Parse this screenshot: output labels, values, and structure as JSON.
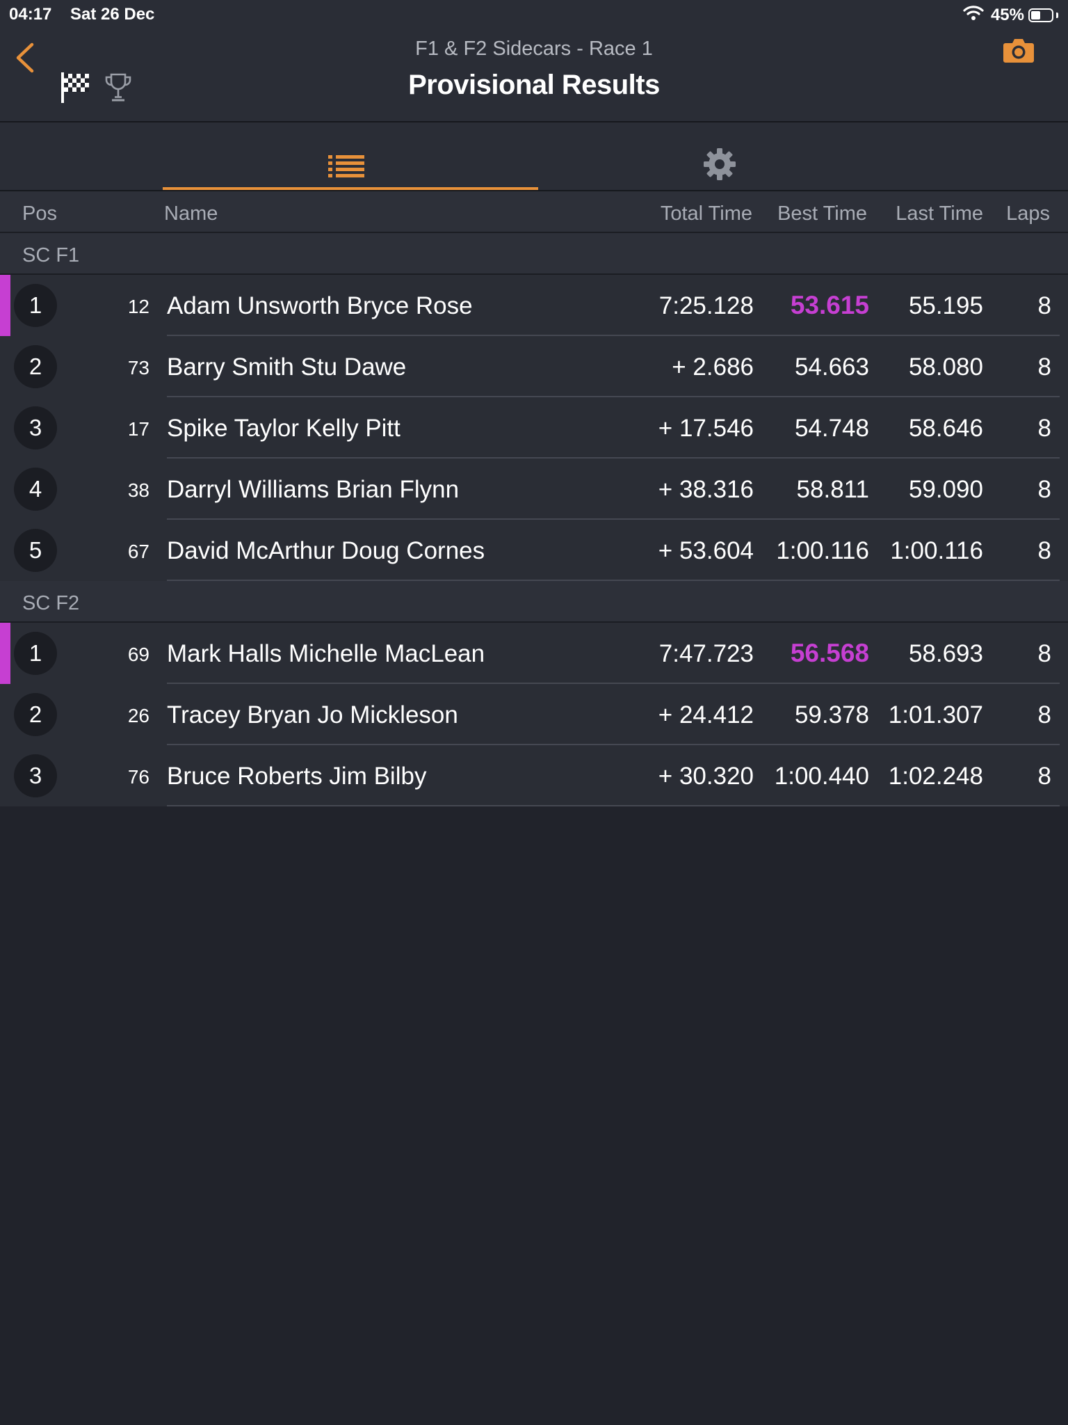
{
  "status_bar": {
    "time": "04:17",
    "date": "Sat 26 Dec",
    "battery": "45%",
    "battery_level": 0.45
  },
  "header": {
    "subtitle": "F1 & F2 Sidecars - Race 1",
    "title": "Provisional Results"
  },
  "icons": {
    "back": "chevron-left-icon",
    "flag": "checkered-flag-icon",
    "trophy": "trophy-icon",
    "camera": "camera-icon",
    "list": "list-icon",
    "settings": "gear-icon",
    "wifi": "wifi-icon",
    "battery": "battery-icon"
  },
  "colors": {
    "accent": "#e8913a",
    "leader": "#c63fd2",
    "background": "#21232b"
  },
  "tabs": [
    {
      "name": "list",
      "active": true
    },
    {
      "name": "settings",
      "active": false
    }
  ],
  "columns": {
    "pos": "Pos",
    "name": "Name",
    "total": "Total Time",
    "best": "Best Time",
    "last": "Last Time",
    "laps": "Laps"
  },
  "groups": [
    {
      "name": "SC F1",
      "rows": [
        {
          "pos": "1",
          "num": "12",
          "name": "Adam Unsworth Bryce Rose",
          "total": "7:25.128",
          "best": "53.615",
          "last": "55.195",
          "laps": "8",
          "leader": true
        },
        {
          "pos": "2",
          "num": "73",
          "name": "Barry Smith Stu Dawe",
          "total": "+ 2.686",
          "best": "54.663",
          "last": "58.080",
          "laps": "8",
          "leader": false
        },
        {
          "pos": "3",
          "num": "17",
          "name": "Spike Taylor Kelly Pitt",
          "total": "+ 17.546",
          "best": "54.748",
          "last": "58.646",
          "laps": "8",
          "leader": false
        },
        {
          "pos": "4",
          "num": "38",
          "name": "Darryl Williams Brian Flynn",
          "total": "+ 38.316",
          "best": "58.811",
          "last": "59.090",
          "laps": "8",
          "leader": false
        },
        {
          "pos": "5",
          "num": "67",
          "name": "David McArthur Doug Cornes",
          "total": "+ 53.604",
          "best": "1:00.116",
          "last": "1:00.116",
          "laps": "8",
          "leader": false
        }
      ]
    },
    {
      "name": "SC F2",
      "rows": [
        {
          "pos": "1",
          "num": "69",
          "name": "Mark Halls Michelle MacLean",
          "total": "7:47.723",
          "best": "56.568",
          "last": "58.693",
          "laps": "8",
          "leader": true
        },
        {
          "pos": "2",
          "num": "26",
          "name": "Tracey Bryan Jo Mickleson",
          "total": "+ 24.412",
          "best": "59.378",
          "last": "1:01.307",
          "laps": "8",
          "leader": false
        },
        {
          "pos": "3",
          "num": "76",
          "name": "Bruce Roberts Jim Bilby",
          "total": "+ 30.320",
          "best": "1:00.440",
          "last": "1:02.248",
          "laps": "8",
          "leader": false
        }
      ]
    }
  ]
}
